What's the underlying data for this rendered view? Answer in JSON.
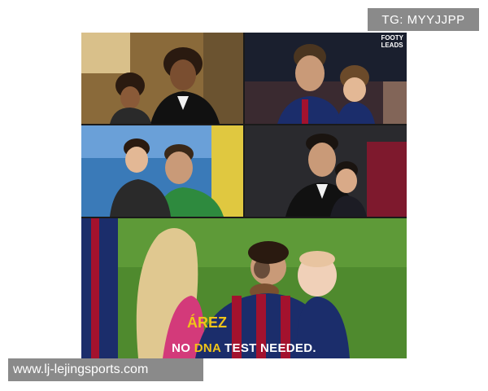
{
  "watermark_top": "TG: MYYJJPP",
  "watermark_bottom": "www.lj-lejingsports.com",
  "logo": {
    "line1": "FOOTY",
    "line2": "LEADS"
  },
  "caption": {
    "part1": "NO ",
    "highlight": "DNA",
    "part2": " TEST NEEDED."
  },
  "jersey_text": "ÁREZ",
  "colors": {
    "highlight": "#f0c419",
    "barca_blue": "#1b2d6b",
    "barca_red": "#a3122e",
    "grass": "#4f8a2e"
  }
}
